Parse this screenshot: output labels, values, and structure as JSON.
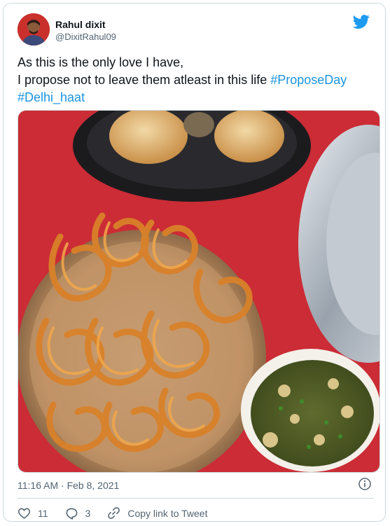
{
  "author": {
    "name": "Rahul dixit",
    "handle": "@DixitRahul09"
  },
  "tweet": {
    "line1": "As this is the only love I have,",
    "line2": "I propose not to leave them atleast in this life",
    "hashtag1": "#ProposeDay",
    "hashtag2": "#Delhi_haat"
  },
  "meta": {
    "time": "11:16 AM",
    "separator": "·",
    "date": "Feb 8, 2021"
  },
  "actions": {
    "likes": "11",
    "replies": "3",
    "copy_link": "Copy link to Tweet"
  },
  "colors": {
    "accent": "#1b95e0",
    "like_icon": "#536471"
  },
  "icons": [
    "twitter-bird-icon",
    "info-icon",
    "heart-icon",
    "reply-icon",
    "link-icon"
  ]
}
